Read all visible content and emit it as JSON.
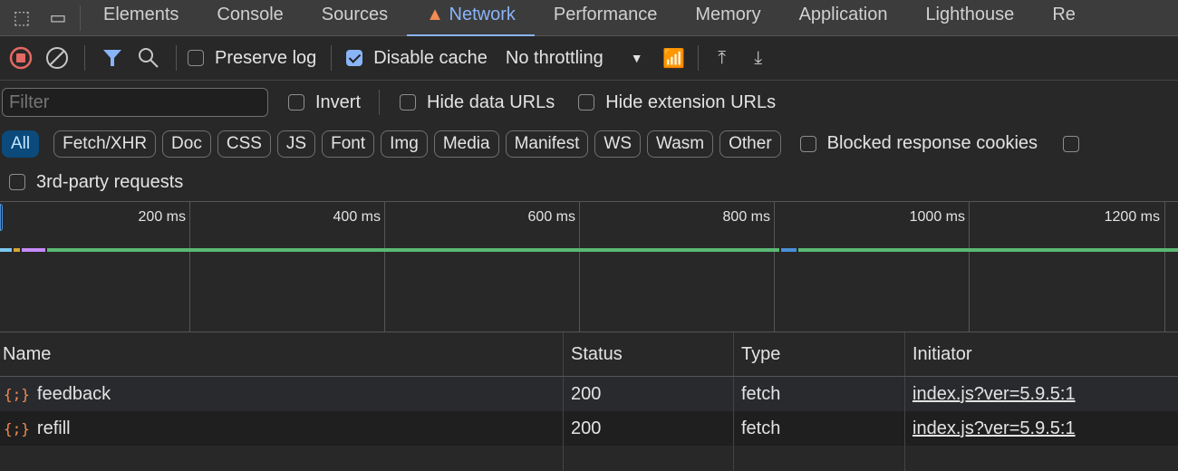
{
  "tabs": [
    "Elements",
    "Console",
    "Sources",
    "Network",
    "Performance",
    "Memory",
    "Application",
    "Lighthouse",
    "Re"
  ],
  "toolbar": {
    "preserve_log": "Preserve log",
    "disable_cache": "Disable cache",
    "throttling": "No throttling"
  },
  "filter": {
    "placeholder": "Filter",
    "invert": "Invert",
    "hide_data_urls": "Hide data URLs",
    "hide_extension_urls": "Hide extension URLs"
  },
  "chips": [
    "All",
    "Fetch/XHR",
    "Doc",
    "CSS",
    "JS",
    "Font",
    "Img",
    "Media",
    "Manifest",
    "WS",
    "Wasm",
    "Other"
  ],
  "blocked_cookies": "Blocked response cookies",
  "third_party": "3rd-party requests",
  "timeline": {
    "ticks": [
      "200 ms",
      "400 ms",
      "600 ms",
      "800 ms",
      "1000 ms",
      "1200 ms"
    ]
  },
  "table": {
    "headers": [
      "Name",
      "Status",
      "Type",
      "Initiator"
    ],
    "rows": [
      {
        "name": "feedback",
        "status": "200",
        "type": "fetch",
        "initiator": "index.js?ver=5.9.5:1"
      },
      {
        "name": "refill",
        "status": "200",
        "type": "fetch",
        "initiator": "index.js?ver=5.9.5:1"
      }
    ]
  }
}
